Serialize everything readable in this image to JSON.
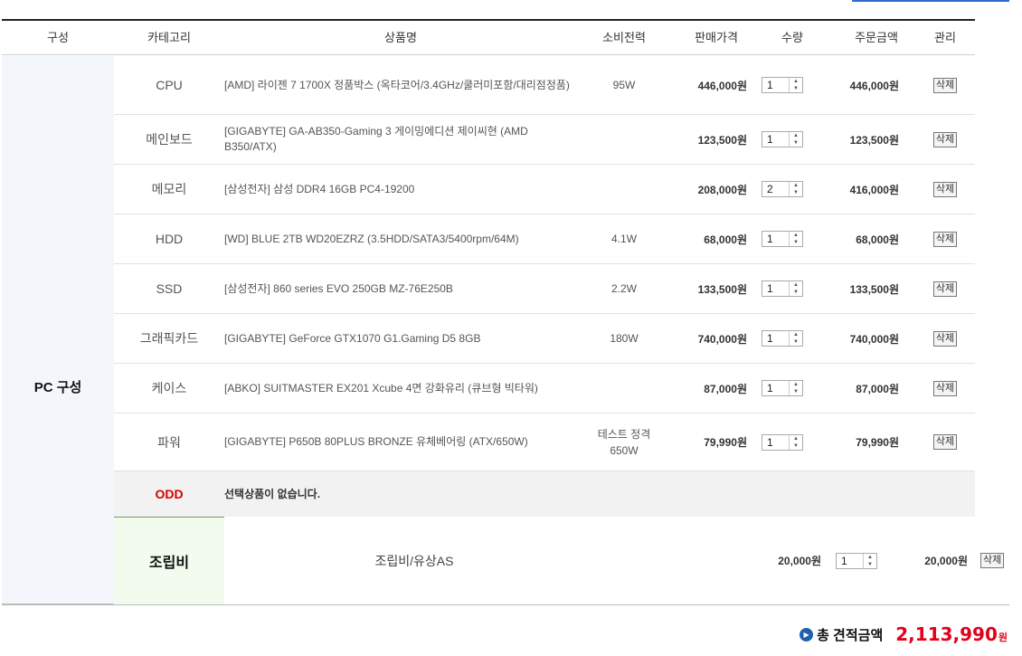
{
  "header": {
    "group": "구성",
    "category": "카테고리",
    "product": "상품명",
    "power": "소비전력",
    "price": "판매가격",
    "qty": "수량",
    "total": "주문금액",
    "manage": "관리"
  },
  "group_label": "PC 구성",
  "rows": [
    {
      "category": "CPU",
      "name": "[AMD] 라이젠 7 1700X 정품박스 (옥타코어/3.4GHz/쿨러미포함/대리점정품)",
      "power": "95W",
      "price": "446,000원",
      "qty": "1",
      "total": "446,000원",
      "delete": "삭제"
    },
    {
      "category": "메인보드",
      "name": "[GIGABYTE] GA-AB350-Gaming 3 게이밍에디션 제이씨현 (AMD B350/ATX)",
      "power": "",
      "price": "123,500원",
      "qty": "1",
      "total": "123,500원",
      "delete": "삭제"
    },
    {
      "category": "메모리",
      "name": "[삼성전자] 삼성 DDR4 16GB PC4-19200",
      "power": "",
      "price": "208,000원",
      "qty": "2",
      "total": "416,000원",
      "delete": "삭제"
    },
    {
      "category": "HDD",
      "name": "[WD] BLUE 2TB WD20EZRZ (3.5HDD/SATA3/5400rpm/64M)",
      "power": "4.1W",
      "price": "68,000원",
      "qty": "1",
      "total": "68,000원",
      "delete": "삭제"
    },
    {
      "category": "SSD",
      "name": "[삼성전자] 860 series EVO 250GB MZ-76E250B",
      "power": "2.2W",
      "price": "133,500원",
      "qty": "1",
      "total": "133,500원",
      "delete": "삭제"
    },
    {
      "category": "그래픽카드",
      "name": "[GIGABYTE] GeForce GTX1070 G1.Gaming D5 8GB",
      "power": "180W",
      "price": "740,000원",
      "qty": "1",
      "total": "740,000원",
      "delete": "삭제"
    },
    {
      "category": "케이스",
      "name": "[ABKO] SUITMASTER EX201 Xcube 4면 강화유리 (큐브형 빅타워)",
      "power": "",
      "price": "87,000원",
      "qty": "1",
      "total": "87,000원",
      "delete": "삭제"
    },
    {
      "category": "파워",
      "name": "[GIGABYTE] P650B 80PLUS BRONZE 유체베어링 (ATX/650W)",
      "power": "테스트 정격 650W",
      "price": "79,990원",
      "qty": "1",
      "total": "79,990원",
      "delete": "삭제"
    }
  ],
  "odd": {
    "category": "ODD",
    "message": "선택상품이 없습니다."
  },
  "assembly": {
    "category": "조립비",
    "name": "조립비/유상AS",
    "price": "20,000원",
    "qty": "1",
    "total": "20,000원",
    "delete": "삭제"
  },
  "summary": {
    "label": "총 견적금액",
    "value": "2,113,990",
    "unit": "원"
  }
}
